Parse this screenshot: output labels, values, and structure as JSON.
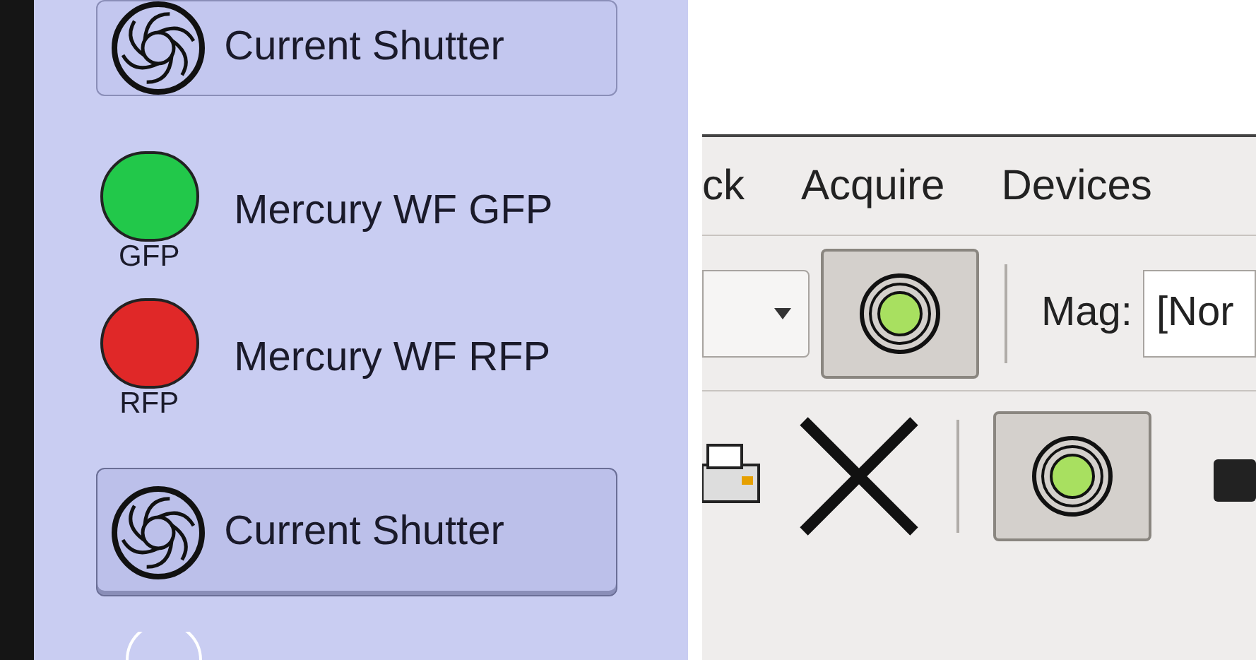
{
  "left_panel": {
    "items": [
      {
        "kind": "shutter",
        "label": "Current Shutter",
        "selected": false
      },
      {
        "kind": "led",
        "label": "Mercury WF GFP",
        "tag": "GFP",
        "color": "#22c84a"
      },
      {
        "kind": "led",
        "label": "Mercury WF RFP",
        "tag": "RFP",
        "color": "#e02828"
      },
      {
        "kind": "shutter",
        "label": "Current Shutter",
        "selected": true
      }
    ]
  },
  "right_panel": {
    "menu": [
      "ck",
      "Acquire",
      "Devices"
    ],
    "toolbar_1": {
      "shutter_pressed": true,
      "mag_label": "Mag:",
      "mag_value": "[Nor"
    },
    "toolbar_2": {
      "shutter_pressed": true
    }
  }
}
